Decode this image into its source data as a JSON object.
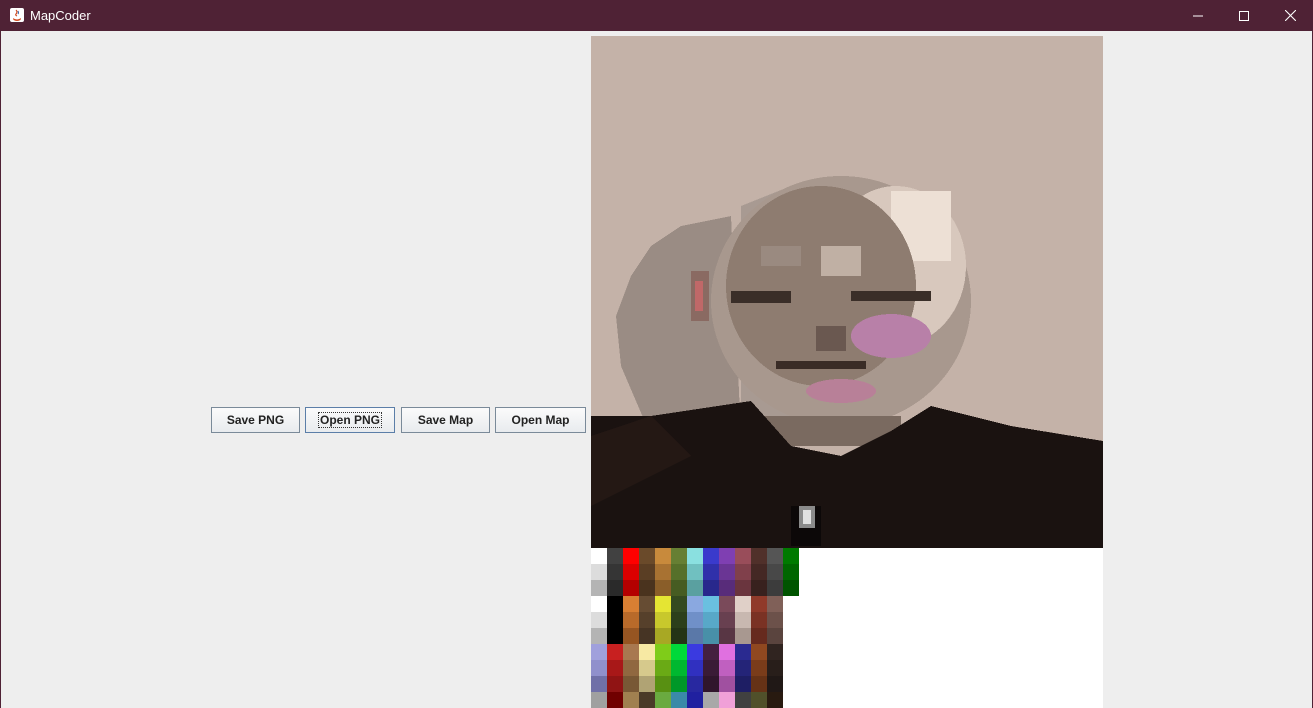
{
  "window": {
    "title": "MapCoder",
    "controls": [
      "minimize",
      "maximize",
      "close"
    ]
  },
  "toolbar": {
    "save_png": "Save PNG",
    "open_png": "Open PNG",
    "save_map": "Save Map",
    "open_map": "Open Map",
    "focused": "open_png"
  },
  "palette": {
    "columns": [
      {
        "top": [
          "#ffffff",
          "#dcdcdc",
          "#b4b4b4"
        ],
        "mid": [
          "#ffffff",
          "#dcdcdc",
          "#b4b4b4"
        ],
        "low": [
          "#a0a0dc",
          "#9090cc",
          "#7070a8"
        ],
        "bottom": "#a0a0a0"
      },
      {
        "top": [
          "#414141",
          "#353535",
          "#2a2a2a"
        ],
        "mid": [
          "#000000",
          "#000000",
          "#000000"
        ],
        "low": [
          "#c82020",
          "#a81818",
          "#901414"
        ],
        "bottom": "#700000"
      },
      {
        "top": [
          "#ff0000",
          "#dc0000",
          "#b40000"
        ],
        "mid": [
          "#d87f33",
          "#b86a2a",
          "#965522"
        ],
        "low": [
          "#a87850",
          "#906840",
          "#785835"
        ],
        "bottom": "#a08050"
      },
      {
        "top": [
          "#6a4a2a",
          "#5a3e24",
          "#4a331e"
        ],
        "mid": [
          "#664c33",
          "#56402b",
          "#463424"
        ],
        "low": [
          "#f7e9a3",
          "#d6c98c",
          "#b0a374"
        ],
        "bottom": "#4a3a28"
      },
      {
        "top": [
          "#c88a3c",
          "#a87232",
          "#8a5e29"
        ],
        "mid": [
          "#e5e533",
          "#c8c82c",
          "#a8a824"
        ],
        "low": [
          "#7fcc19",
          "#6aaa15",
          "#589012"
        ],
        "bottom": "#6aaa40"
      },
      {
        "top": [
          "#667f33",
          "#56702a",
          "#465c22"
        ],
        "mid": [
          "#344a20",
          "#2c3f1b",
          "#243416"
        ],
        "low": [
          "#00d93a",
          "#00b830",
          "#009828"
        ],
        "bottom": "#3a8aa8"
      },
      {
        "top": [
          "#8ae0e0",
          "#70c0c0",
          "#5aa0a0"
        ],
        "mid": [
          "#8aa8e0",
          "#7090c8",
          "#5a78a8"
        ],
        "low": [
          "#3a3ae0",
          "#3030c0",
          "#2828a0"
        ],
        "bottom": "#2020a0"
      },
      {
        "top": [
          "#3a3acc",
          "#3030aa",
          "#28288c"
        ],
        "mid": [
          "#6ac0e0",
          "#58a8c8",
          "#4890a8"
        ],
        "low": [
          "#442040",
          "#3a1b36",
          "#30162c"
        ],
        "bottom": "#a8a8a8"
      },
      {
        "top": [
          "#7f3fb2",
          "#6a3594",
          "#582c7a"
        ],
        "mid": [
          "#7a4a5a",
          "#684050",
          "#583644"
        ],
        "low": [
          "#e070e0",
          "#c060c0",
          "#a050a0"
        ],
        "bottom": "#f0a0d8"
      },
      {
        "top": [
          "#994d5a",
          "#80404b",
          "#6a353e"
        ],
        "mid": [
          "#e0d0c8",
          "#c8b8b0",
          "#a89890"
        ],
        "low": [
          "#2a2a90",
          "#242478",
          "#1e1e64"
        ],
        "bottom": "#404040"
      },
      {
        "top": [
          "#50302a",
          "#442824",
          "#38211e"
        ],
        "mid": [
          "#903a2a",
          "#7a3224",
          "#662a1e"
        ],
        "low": [
          "#904820",
          "#7a3c1a",
          "#663216"
        ],
        "bottom": "#50502a"
      },
      {
        "top": [
          "#555555",
          "#484848",
          "#3c3c3c"
        ],
        "mid": [
          "#806058",
          "#6c514a",
          "#5a443e"
        ],
        "low": [
          "#302420",
          "#281e1a",
          "#201816"
        ],
        "bottom": "#281a10"
      },
      {
        "top": [
          "#007a00",
          "#006600",
          "#005400"
        ],
        "mid": null,
        "low": null,
        "bottom": null
      }
    ]
  }
}
